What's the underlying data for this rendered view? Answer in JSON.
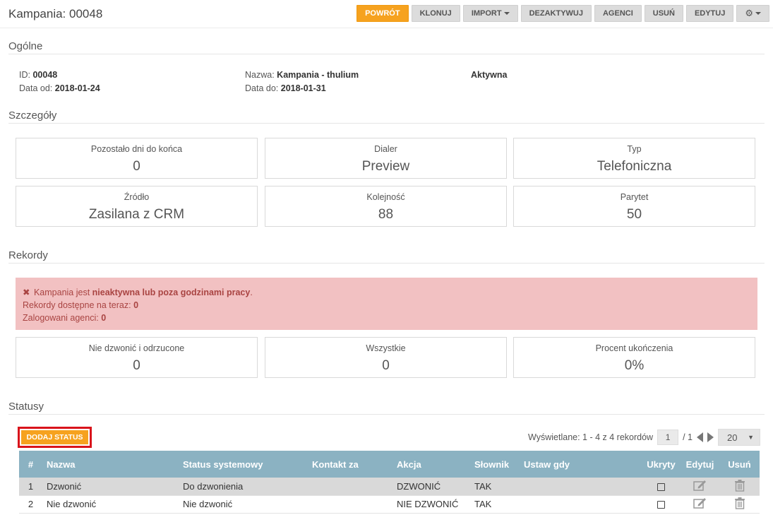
{
  "header": {
    "title": "Kampania: 00048",
    "buttons": {
      "back": "POWRÓT",
      "clone": "KLONUJ",
      "import": "IMPORT",
      "deactivate": "DEZAKTYWUJ",
      "agents": "AGENCI",
      "delete": "USUŃ",
      "edit": "EDYTUJ"
    },
    "settings_icon": "gear-icon"
  },
  "general": {
    "title": "Ogólne",
    "id_label": "ID:",
    "id_value": "00048",
    "date_from_label": "Data od:",
    "date_from_value": "2018-01-24",
    "name_label": "Nazwa:",
    "name_value": "Kampania - thulium",
    "date_to_label": "Data do:",
    "date_to_value": "2018-01-31",
    "state": "Aktywna"
  },
  "details": {
    "title": "Szczegóły",
    "stats": [
      {
        "label": "Pozostało dni do końca",
        "value": "0"
      },
      {
        "label": "Dialer",
        "value": "Preview"
      },
      {
        "label": "Typ",
        "value": "Telefoniczna"
      },
      {
        "label": "Źródło",
        "value": "Zasilana z CRM"
      },
      {
        "label": "Kolejność",
        "value": "88"
      },
      {
        "label": "Parytet",
        "value": "50"
      }
    ]
  },
  "records": {
    "title": "Rekordy",
    "alert": {
      "icon": "close-icon",
      "prefix": "Kampania jest",
      "emphasis": "nieaktywna lub poza godzinami pracy",
      "suffix": ".",
      "available_label": "Rekordy dostępne na teraz:",
      "available_value": "0",
      "agents_label": "Zalogowani agenci:",
      "agents_value": "0",
      "color": "#f2c1c2"
    },
    "stats": [
      {
        "label": "Nie dzwonić i odrzucone",
        "value": "0"
      },
      {
        "label": "Wszystkie",
        "value": "0"
      },
      {
        "label": "Procent ukończenia",
        "value": "0%"
      }
    ]
  },
  "statuses": {
    "title": "Statusy",
    "add_button": "DODAJ STATUS",
    "pager": {
      "info": "Wyświetlane: 1 - 4 z 4 rekordów",
      "page": "1",
      "of": "/ 1",
      "per_page": "20"
    },
    "columns": [
      "#",
      "Nazwa",
      "Status systemowy",
      "Kontakt za",
      "Akcja",
      "Słownik",
      "Ustaw gdy",
      "Ukryty",
      "Edytuj",
      "Usuń"
    ],
    "rows": [
      {
        "num": "1",
        "name": "Dzwonić",
        "system_status": "Do dzwonienia",
        "contact_after": "",
        "action": "DZWONIĆ",
        "dictionary": "TAK",
        "set_when": ""
      },
      {
        "num": "2",
        "name": "Nie dzwonić",
        "system_status": "Nie dzwonić",
        "contact_after": "",
        "action": "NIE DZWONIĆ",
        "dictionary": "TAK",
        "set_when": ""
      }
    ],
    "header_color": "#8bb2c2"
  },
  "colors": {
    "primary": "#f6a21f",
    "highlight_border": "#d9141b"
  }
}
